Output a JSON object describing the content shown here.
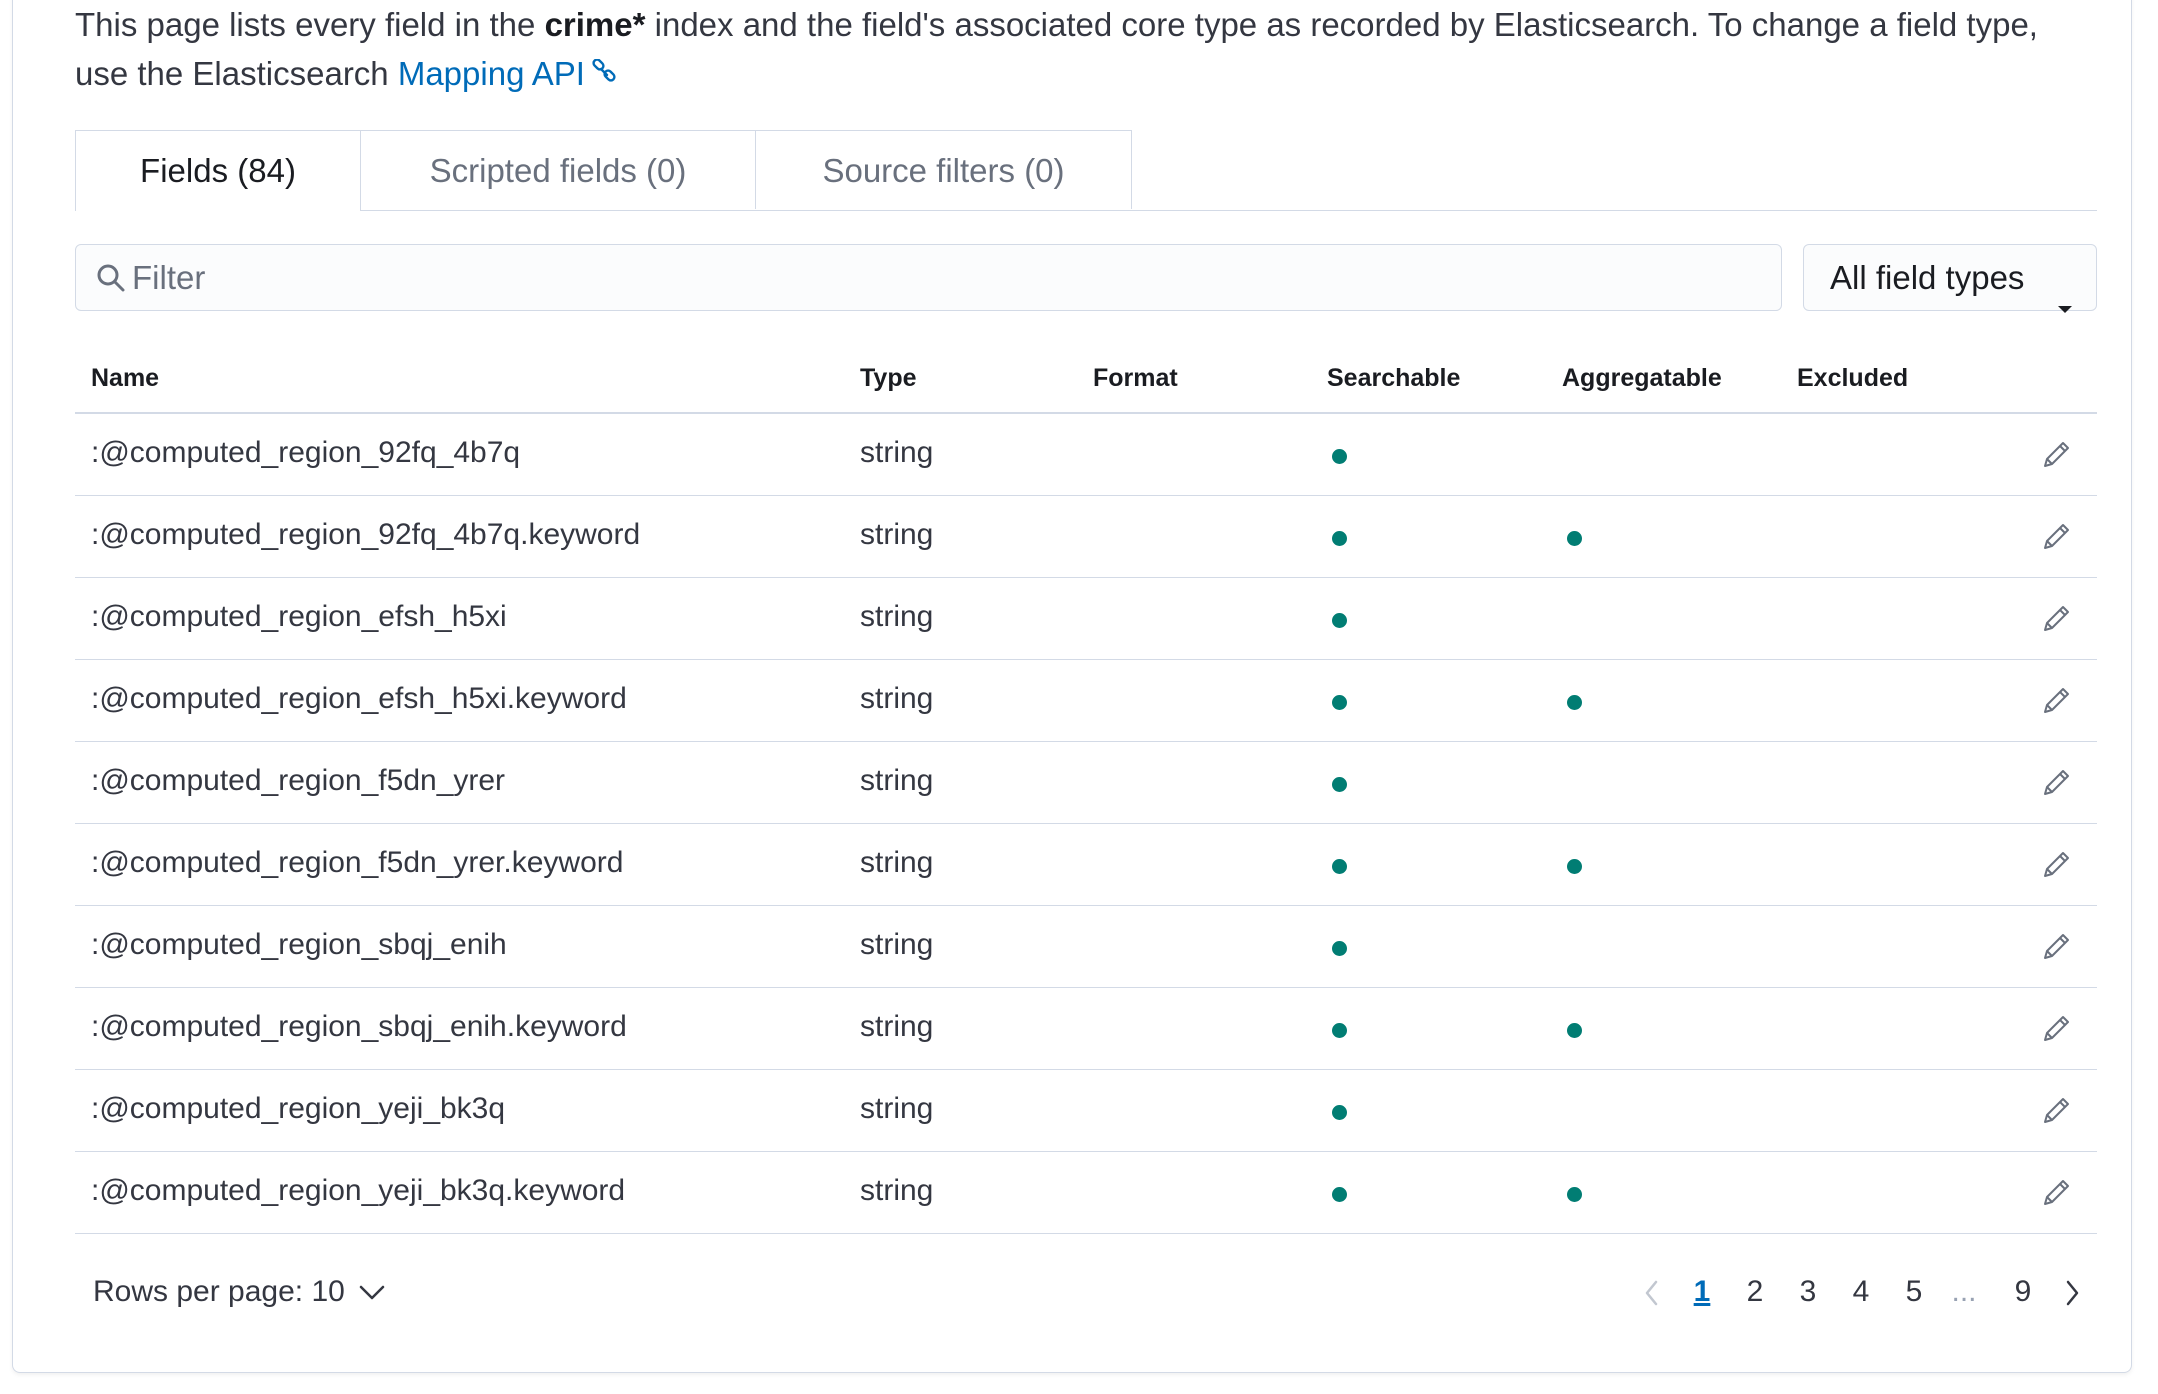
{
  "intro": {
    "before": "This page lists every field in the ",
    "index_name": "crime*",
    "after": " index and the field's associated core type as recorded by Elasticsearch. To change a field type, use the Elasticsearch ",
    "link_text": "Mapping API"
  },
  "tabs": [
    {
      "label": "Fields (84)",
      "active": true
    },
    {
      "label": "Scripted fields (0)",
      "active": false
    },
    {
      "label": "Source filters (0)",
      "active": false
    }
  ],
  "filter": {
    "placeholder": "Filter",
    "value": ""
  },
  "type_select": {
    "selected": "All field types"
  },
  "table": {
    "columns": [
      "Name",
      "Type",
      "Format",
      "Searchable",
      "Aggregatable",
      "Excluded"
    ],
    "rows": [
      {
        "name": ":@computed_region_92fq_4b7q",
        "type": "string",
        "format": "",
        "searchable": true,
        "aggregatable": false,
        "excluded": false
      },
      {
        "name": ":@computed_region_92fq_4b7q.keyword",
        "type": "string",
        "format": "",
        "searchable": true,
        "aggregatable": true,
        "excluded": false
      },
      {
        "name": ":@computed_region_efsh_h5xi",
        "type": "string",
        "format": "",
        "searchable": true,
        "aggregatable": false,
        "excluded": false
      },
      {
        "name": ":@computed_region_efsh_h5xi.keyword",
        "type": "string",
        "format": "",
        "searchable": true,
        "aggregatable": true,
        "excluded": false
      },
      {
        "name": ":@computed_region_f5dn_yrer",
        "type": "string",
        "format": "",
        "searchable": true,
        "aggregatable": false,
        "excluded": false
      },
      {
        "name": ":@computed_region_f5dn_yrer.keyword",
        "type": "string",
        "format": "",
        "searchable": true,
        "aggregatable": true,
        "excluded": false
      },
      {
        "name": ":@computed_region_sbqj_enih",
        "type": "string",
        "format": "",
        "searchable": true,
        "aggregatable": false,
        "excluded": false
      },
      {
        "name": ":@computed_region_sbqj_enih.keyword",
        "type": "string",
        "format": "",
        "searchable": true,
        "aggregatable": true,
        "excluded": false
      },
      {
        "name": ":@computed_region_yeji_bk3q",
        "type": "string",
        "format": "",
        "searchable": true,
        "aggregatable": false,
        "excluded": false
      },
      {
        "name": ":@computed_region_yeji_bk3q.keyword",
        "type": "string",
        "format": "",
        "searchable": true,
        "aggregatable": true,
        "excluded": false
      }
    ]
  },
  "pagination": {
    "rows_per_page_label": "Rows per page: 10",
    "pages": [
      "1",
      "2",
      "3",
      "4",
      "5",
      "...",
      "9"
    ],
    "current_page": "1"
  },
  "colors": {
    "accent": "#006bb8",
    "indicator": "#017d73",
    "border": "#d3dae6"
  },
  "icons": {
    "external_link": "link-icon",
    "search": "search-icon",
    "select_caret": "caret-down-icon",
    "edit": "pencil-icon",
    "prev": "chevron-left-icon",
    "next": "chevron-right-icon",
    "rows_dropdown": "chevron-down-icon"
  }
}
